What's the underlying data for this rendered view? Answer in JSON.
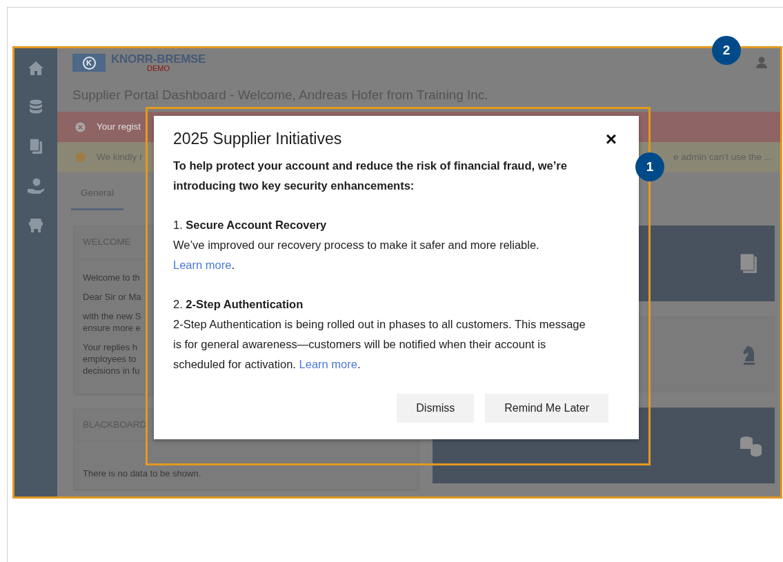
{
  "header": {
    "logo_mark": "K",
    "logo_text": "KNORR-BREMSE",
    "logo_badge": "DEMO"
  },
  "title": "Supplier Portal Dashboard - Welcome, Andreas Hofer from Training Inc.",
  "alerts": [
    {
      "kind": "error",
      "text": "Your regist"
    },
    {
      "kind": "warning",
      "text": "We kindly r",
      "text_right": "e admin can't use the ..."
    }
  ],
  "tabs": [
    {
      "label": "General",
      "selected": true
    }
  ],
  "welcome_card": {
    "title": "WELCOME",
    "paragraphs": [
      [
        "Welcome to th"
      ],
      [
        "Dear Sir or Ma"
      ],
      [
        "with the new S",
        "ensure more e"
      ],
      [
        "Your replies h",
        "employees to",
        "decisions in fu"
      ]
    ]
  },
  "blackboard_card": {
    "title": "BLACKBOARD",
    "text": "There is no data to be shown."
  },
  "tiles": [
    {
      "kind": "dark"
    },
    {
      "kind": "light"
    },
    {
      "kind": "dark"
    }
  ],
  "modal": {
    "title": "2025 Supplier Initiatives",
    "close": "×",
    "intro": "To help protect your account and reduce the risk of financial fraud, we’re introducing two key security enhancements:",
    "sections": [
      {
        "number": "1.",
        "heading": "Secure Account Recovery",
        "text": "We’ve improved our recovery process to make it safer and more reliable.",
        "link": "Learn more",
        "tail": "."
      },
      {
        "number": "2.",
        "heading": "2-Step Authentication",
        "text": "2-Step Authentication is being rolled out in phases to all customers. This message is for general awareness—customers will be notified when their account is scheduled for activation.",
        "link": "Learn more",
        "tail": "."
      }
    ],
    "buttons": [
      "Dismiss",
      "Remind Me Later"
    ]
  },
  "callouts": [
    "1",
    "2"
  ]
}
